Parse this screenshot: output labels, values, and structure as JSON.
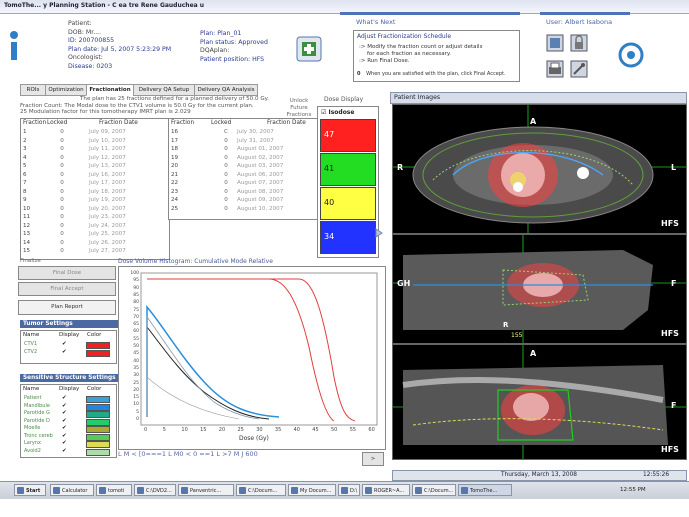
{
  "window": {
    "title": "TomoThe... y Planning Station - C  ea tre Rene Gauduchea u"
  },
  "patient": {
    "patient_label": "Patient:",
    "dob": "DOB: Mr....",
    "id": "ID: 200700855",
    "plan_date": "Plan date: Jul 5, 2007 5:23:29 PM",
    "oncologist": "Oncologist:",
    "disease": "Disease: 0203",
    "plan": "Plan: Plan_01",
    "plan_status": "Plan status: Approved",
    "dqaplan": "DQAplan:",
    "patient_position": "Patient position: HFS"
  },
  "whats_next": {
    "title": "What's Next",
    "heading": "Adjust Fractionization Schedule",
    "lines": [
      ":> Modify the fraction count or adjust details",
      "for each fraction as necessary.",
      ":> Run Final Dose.",
      "When you are satisfied with the plan, click Final Accept."
    ],
    "bullet": "0"
  },
  "user": {
    "label": "User: Albert Isabona"
  },
  "tabs": [
    "ROIs",
    "Optimization",
    "Fractionation",
    "Delivery QA Setup",
    "Delivery QA Analysis"
  ],
  "summary": {
    "line1": "The plan has 25 fractions defined for a planned delivery of 50.0 Gy.",
    "line2": "Fraction Count: The Modal dose to the CTV1 volume is 50.0 Gy for the current plan.",
    "line3": "25          Modulation factor for this tomotherapy IMRT plan is 2.029"
  },
  "fraction_table": {
    "headers": [
      "Fraction",
      "Locked",
      "Fraction Date"
    ],
    "left": [
      [
        "1",
        "0",
        "July 09, 2007"
      ],
      [
        "2",
        "0",
        "July 10, 2007"
      ],
      [
        "3",
        "0",
        "July 11, 2007"
      ],
      [
        "4",
        "0",
        "July 12, 2007"
      ],
      [
        "5",
        "0",
        "July 13, 2007"
      ],
      [
        "6",
        "0",
        "July 16, 2007"
      ],
      [
        "7",
        "0",
        "July 17, 2007"
      ],
      [
        "8",
        "0",
        "July 18, 2007"
      ],
      [
        "9",
        "0",
        "July 19, 2007"
      ],
      [
        "10",
        "0",
        "July 20, 2007"
      ],
      [
        "11",
        "0",
        "July 23, 2007"
      ],
      [
        "12",
        "0",
        "July 24, 2007"
      ],
      [
        "13",
        "0",
        "July 25, 2007"
      ],
      [
        "14",
        "0",
        "July 26, 2007"
      ],
      [
        "15",
        "0",
        "July 27, 2007"
      ]
    ],
    "right": [
      [
        "16",
        "C",
        "July 30, 2007"
      ],
      [
        "17",
        "0",
        "July 31, 2007"
      ],
      [
        "18",
        "0",
        "August 01, 2007"
      ],
      [
        "19",
        "0",
        "August 02, 2007"
      ],
      [
        "20",
        "0",
        "August 03, 2007"
      ],
      [
        "21",
        "0",
        "August 06, 2007"
      ],
      [
        "22",
        "0",
        "August 07, 2007"
      ],
      [
        "23",
        "0",
        "August 08, 2007"
      ],
      [
        "24",
        "0",
        "August 09, 2007"
      ],
      [
        "25",
        "0",
        "August 10, 2007"
      ]
    ],
    "unlock_label": "Unlock Future Fractions"
  },
  "dose_display": {
    "title": "Dose Display",
    "isodose_label": "Isodose",
    "levels": [
      {
        "value": "47",
        "color": "#ff2020"
      },
      {
        "value": "41",
        "color": "#22dd22"
      },
      {
        "value": "40",
        "color": "#ffff44"
      },
      {
        "value": "34",
        "color": "#2233ff"
      }
    ]
  },
  "left_buttons": {
    "finalize": "Finalize",
    "final_dose": "Final Dose",
    "final_accept": "Final Accept",
    "plan_report": "Plan Report"
  },
  "tumor_settings": {
    "title": "Tumor Settings",
    "headers": [
      "Name",
      "Display",
      "Color"
    ],
    "rows": [
      {
        "name": "CTV1",
        "color": "#ee2222"
      },
      {
        "name": "CTV2",
        "color": "#ee2222"
      }
    ]
  },
  "sensitive_settings": {
    "title": "Sensitive Structure Settings",
    "headers": [
      "Name",
      "Display",
      "Color"
    ],
    "rows": [
      {
        "name": "Patient",
        "color": "#3aa0d8"
      },
      {
        "name": "Mandibule",
        "color": "#2288dd"
      },
      {
        "name": "Parotide G",
        "color": "#22aa88"
      },
      {
        "name": "Parotide D",
        "color": "#22cc66"
      },
      {
        "name": "Moelle",
        "color": "#aaaa33"
      },
      {
        "name": "Tronc cereb",
        "color": "#55cc55"
      },
      {
        "name": "Larynx",
        "color": "#dddd55"
      },
      {
        "name": "Avoid2",
        "color": "#aaddaa"
      }
    ]
  },
  "dvh": {
    "header": "Dose Volume Histogram:  Cumulative Mode Relative",
    "xlabel": "Dose (Gy)",
    "x_ticks": [
      "0",
      "5",
      "10",
      "15",
      "20",
      "25",
      "30",
      "35",
      "40",
      "45",
      "50",
      "55",
      "60"
    ],
    "y_ticks": [
      "100",
      "95",
      "90",
      "85",
      "80",
      "75",
      "70",
      "65",
      "60",
      "55",
      "50",
      "45",
      "40",
      "35",
      "30",
      "25",
      "20",
      "15",
      "10",
      "5",
      "0"
    ],
    "bottom_text": "L  M  <  [0===1 L M0 < 0 ==1 L >7   M  J  600"
  },
  "patient_images": {
    "title": "Patient Images",
    "views": [
      {
        "top": "A",
        "left": "R",
        "right": "L",
        "corner": "HFS"
      },
      {
        "top": "",
        "left": "GH",
        "right": "F",
        "corner": "HFS"
      },
      {
        "top": "A",
        "left": "",
        "right": "F",
        "corner": "HFS"
      }
    ],
    "mid_label": "R",
    "mid_value": "155"
  },
  "status": {
    "date": "Thursday, March 13, 2008",
    "time": "12:55:26"
  },
  "taskbar": {
    "start": "Start",
    "items": [
      "Calculator",
      "tomoti",
      "C:\\DVD2...",
      "Panventric...",
      "C:\\Docum...",
      "My Docum...",
      "D:\\",
      "ROGER~A...",
      "C:\\Docum...",
      "TomoThe..."
    ],
    "clock": "12:55 PM"
  }
}
